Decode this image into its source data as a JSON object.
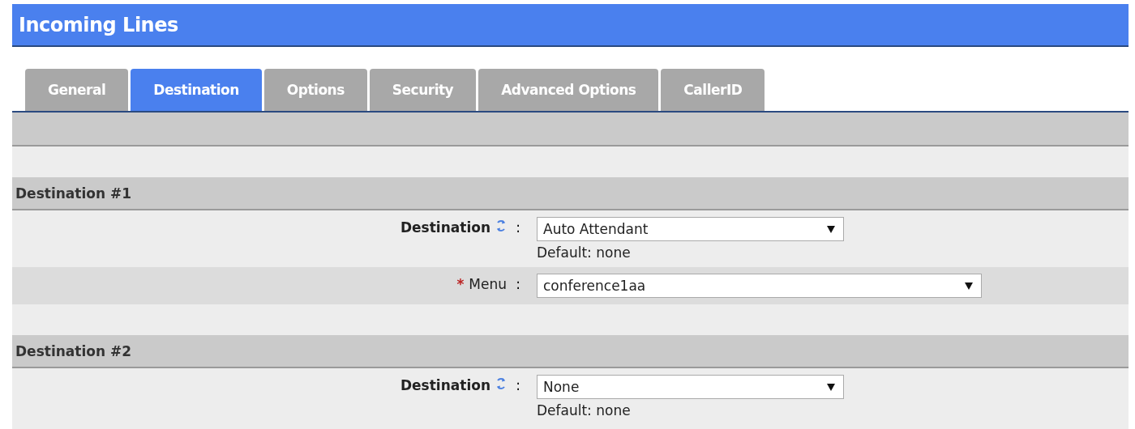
{
  "header": {
    "title": "Incoming Lines"
  },
  "tabs": [
    {
      "label": "General",
      "selected": false
    },
    {
      "label": "Destination",
      "selected": true
    },
    {
      "label": "Options",
      "selected": false
    },
    {
      "label": "Security",
      "selected": false
    },
    {
      "label": "Advanced Options",
      "selected": false
    },
    {
      "label": "CallerID",
      "selected": false
    }
  ],
  "sections": [
    {
      "title": "Destination #1",
      "fields": [
        {
          "kind": "primary",
          "label": "Destination",
          "separator": ":",
          "value": "Auto Attendant",
          "hint": "Default: none"
        },
        {
          "kind": "sub",
          "label": "Menu",
          "required_mark": "*",
          "separator": ":",
          "value": "conference1aa"
        }
      ]
    },
    {
      "title": "Destination #2",
      "fields": [
        {
          "kind": "primary",
          "label": "Destination",
          "separator": ":",
          "value": "None",
          "hint": "Default: none"
        }
      ]
    }
  ]
}
